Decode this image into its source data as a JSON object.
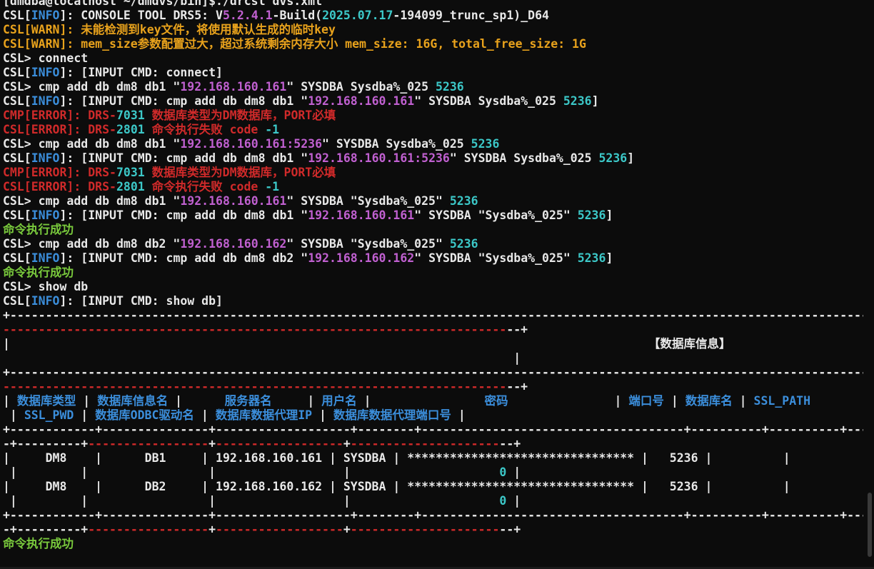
{
  "terminal": {
    "colors": {
      "white": "#e8e8e8",
      "cyan": "#3cc8c8",
      "magenta": "#c060d0",
      "blue": "#3b8edb",
      "yellow": "#e8a21c",
      "red": "#d02a2a",
      "green": "#79c93c",
      "dashred": "#d02a2a"
    },
    "lines": [
      {
        "segs": [
          {
            "t": "[dmdba@localhost ~/dmdvs/bin]$./drcsl dvs.xml",
            "c": "white"
          }
        ]
      },
      {
        "segs": [
          {
            "t": "CSL[",
            "c": "white"
          },
          {
            "t": "INFO",
            "c": "blue"
          },
          {
            "t": "]: CONSOLE TOOL DRS5: V",
            "c": "white"
          },
          {
            "t": "5.2.4.1",
            "c": "magenta"
          },
          {
            "t": "-Build(",
            "c": "white"
          },
          {
            "t": "2025.07.17",
            "c": "cyan"
          },
          {
            "t": "-194099_trunc_sp1)_D64",
            "c": "white"
          }
        ]
      },
      {
        "segs": [
          {
            "t": "CSL[WARN]: 未能检测到key文件，将使用默认生成的临时key",
            "c": "yellow"
          }
        ]
      },
      {
        "segs": [
          {
            "t": "CSL[WARN]: mem_size参数配置过大，超过系统剩余内存大小 mem_size: 16G, total_free_size: 1G",
            "c": "yellow"
          }
        ]
      },
      {
        "segs": [
          {
            "t": "CSL> connect",
            "c": "white"
          }
        ]
      },
      {
        "segs": [
          {
            "t": "CSL[",
            "c": "white"
          },
          {
            "t": "INFO",
            "c": "blue"
          },
          {
            "t": "]: [INPUT CMD: connect]",
            "c": "white"
          }
        ]
      },
      {
        "segs": [
          {
            "t": "CSL> cmp add db dm8 db1 \"",
            "c": "white"
          },
          {
            "t": "192.168.160.161",
            "c": "magenta"
          },
          {
            "t": "\" SYSDBA Sysdba%_025 ",
            "c": "white"
          },
          {
            "t": "5236",
            "c": "cyan"
          }
        ]
      },
      {
        "segs": [
          {
            "t": "CSL[",
            "c": "white"
          },
          {
            "t": "INFO",
            "c": "blue"
          },
          {
            "t": "]: [INPUT CMD: cmp add db dm8 db1 \"",
            "c": "white"
          },
          {
            "t": "192.168.160.161",
            "c": "magenta"
          },
          {
            "t": "\" SYSDBA Sysdba%_025 ",
            "c": "white"
          },
          {
            "t": "5236",
            "c": "cyan"
          },
          {
            "t": "]",
            "c": "white"
          }
        ]
      },
      {
        "segs": [
          {
            "t": "CMP[ERROR]: DRS-",
            "c": "red"
          },
          {
            "t": "7031",
            "c": "cyan"
          },
          {
            "t": " 数据库类型为DM数据库，PORT必填",
            "c": "red"
          }
        ]
      },
      {
        "segs": [
          {
            "t": "CSL[ERROR]: DRS-",
            "c": "red"
          },
          {
            "t": "2801",
            "c": "cyan"
          },
          {
            "t": " 命令执行失败 code ",
            "c": "red"
          },
          {
            "t": "-1",
            "c": "cyan"
          }
        ]
      },
      {
        "segs": [
          {
            "t": "CSL> cmp add db dm8 db1 \"",
            "c": "white"
          },
          {
            "t": "192.168.160.161:5236",
            "c": "magenta"
          },
          {
            "t": "\" SYSDBA Sysdba%_025 ",
            "c": "white"
          },
          {
            "t": "5236",
            "c": "cyan"
          }
        ]
      },
      {
        "segs": [
          {
            "t": "CSL[",
            "c": "white"
          },
          {
            "t": "INFO",
            "c": "blue"
          },
          {
            "t": "]: [INPUT CMD: cmp add db dm8 db1 \"",
            "c": "white"
          },
          {
            "t": "192.168.160.161:5236",
            "c": "magenta"
          },
          {
            "t": "\" SYSDBA Sysdba%_025 ",
            "c": "white"
          },
          {
            "t": "5236",
            "c": "cyan"
          },
          {
            "t": "]",
            "c": "white"
          }
        ]
      },
      {
        "segs": [
          {
            "t": "CMP[ERROR]: DRS-",
            "c": "red"
          },
          {
            "t": "7031",
            "c": "cyan"
          },
          {
            "t": " 数据库类型为DM数据库，PORT必填",
            "c": "red"
          }
        ]
      },
      {
        "segs": [
          {
            "t": "CSL[ERROR]: DRS-",
            "c": "red"
          },
          {
            "t": "2801",
            "c": "cyan"
          },
          {
            "t": " 命令执行失败 code ",
            "c": "red"
          },
          {
            "t": "-1",
            "c": "cyan"
          }
        ]
      },
      {
        "segs": [
          {
            "t": "CSL> cmp add db dm8 db1 \"",
            "c": "white"
          },
          {
            "t": "192.168.160.161",
            "c": "magenta"
          },
          {
            "t": "\" SYSDBA \"Sysdba%_025\" ",
            "c": "white"
          },
          {
            "t": "5236",
            "c": "cyan"
          }
        ]
      },
      {
        "segs": [
          {
            "t": "CSL[",
            "c": "white"
          },
          {
            "t": "INFO",
            "c": "blue"
          },
          {
            "t": "]: [INPUT CMD: cmp add db dm8 db1 \"",
            "c": "white"
          },
          {
            "t": "192.168.160.161",
            "c": "magenta"
          },
          {
            "t": "\" SYSDBA \"Sysdba%_025\" ",
            "c": "white"
          },
          {
            "t": "5236",
            "c": "cyan"
          },
          {
            "t": "]",
            "c": "white"
          }
        ]
      },
      {
        "segs": [
          {
            "t": "命令执行成功",
            "c": "green"
          }
        ]
      },
      {
        "segs": [
          {
            "t": "CSL> cmp add db dm8 db2 \"",
            "c": "white"
          },
          {
            "t": "192.168.160.162",
            "c": "magenta"
          },
          {
            "t": "\" SYSDBA \"Sysdba%_025\" ",
            "c": "white"
          },
          {
            "t": "5236",
            "c": "cyan"
          }
        ]
      },
      {
        "segs": [
          {
            "t": "CSL[",
            "c": "white"
          },
          {
            "t": "INFO",
            "c": "blue"
          },
          {
            "t": "]: [INPUT CMD: cmp add db dm8 db2 \"",
            "c": "white"
          },
          {
            "t": "192.168.160.162",
            "c": "magenta"
          },
          {
            "t": "\" SYSDBA \"Sysdba%_025\" ",
            "c": "white"
          },
          {
            "t": "5236",
            "c": "cyan"
          },
          {
            "t": "]",
            "c": "white"
          }
        ]
      },
      {
        "segs": [
          {
            "t": "命令执行成功",
            "c": "green"
          }
        ]
      },
      {
        "segs": [
          {
            "t": "CSL> show db",
            "c": "white"
          }
        ]
      },
      {
        "segs": [
          {
            "t": "CSL[",
            "c": "white"
          },
          {
            "t": "INFO",
            "c": "blue"
          },
          {
            "t": "]: [INPUT CMD: show db]",
            "c": "white"
          }
        ]
      },
      {
        "segs": [
          {
            "t": "+-------------------------------------------------------------------------------------------------------------------------------------------------------------------------",
            "c": "white"
          }
        ]
      },
      {
        "segs": [
          {
            "t": "-----------------------------------------------------------------------",
            "c": "dashred"
          },
          {
            "t": "--+",
            "c": "white"
          }
        ]
      },
      {
        "segs": [
          {
            "t": "|                                                                                          【数据库信息】",
            "c": "white"
          }
        ]
      },
      {
        "segs": [
          {
            "t": "                                                                        |",
            "c": "white"
          }
        ]
      },
      {
        "segs": [
          {
            "t": "+-------------------------------------------------------------------------------------------------------------------------------------------------------------------------",
            "c": "white"
          }
        ]
      },
      {
        "segs": [
          {
            "t": "-----------------------------------------------------------------------",
            "c": "dashred"
          },
          {
            "t": "--+",
            "c": "white"
          }
        ]
      },
      {
        "segs": [
          {
            "t": "| ",
            "c": "white"
          },
          {
            "t": "数据库类型",
            "c": "blue"
          },
          {
            "t": " | ",
            "c": "white"
          },
          {
            "t": "数据库信息名",
            "c": "blue"
          },
          {
            "t": " |      ",
            "c": "white"
          },
          {
            "t": "服务器名",
            "c": "blue"
          },
          {
            "t": "     | ",
            "c": "white"
          },
          {
            "t": "用户名",
            "c": "blue"
          },
          {
            "t": " |                ",
            "c": "white"
          },
          {
            "t": "密码",
            "c": "blue"
          },
          {
            "t": "               | ",
            "c": "white"
          },
          {
            "t": "端口号",
            "c": "blue"
          },
          {
            "t": " | ",
            "c": "white"
          },
          {
            "t": "数据库名",
            "c": "blue"
          },
          {
            "t": " | ",
            "c": "white"
          },
          {
            "t": "SSL_PATH",
            "c": "blue"
          }
        ]
      },
      {
        "segs": [
          {
            "t": " | ",
            "c": "white"
          },
          {
            "t": "SSL_PWD",
            "c": "blue"
          },
          {
            "t": " | ",
            "c": "white"
          },
          {
            "t": "数据库ODBC驱动名",
            "c": "blue"
          },
          {
            "t": " | ",
            "c": "white"
          },
          {
            "t": "数据库数据代理IP",
            "c": "blue"
          },
          {
            "t": " | ",
            "c": "white"
          },
          {
            "t": "数据库数据代理端口号",
            "c": "blue"
          },
          {
            "t": " |",
            "c": "white"
          }
        ]
      },
      {
        "segs": [
          {
            "t": "+------------+---------------+-------------------+--------+-------------------------------------+----------+----------+----------",
            "c": "white"
          }
        ]
      },
      {
        "segs": [
          {
            "t": "-+---------+",
            "c": "white"
          },
          {
            "t": "-----------------",
            "c": "dashred"
          },
          {
            "t": "+",
            "c": "white"
          },
          {
            "t": "------------------",
            "c": "dashred"
          },
          {
            "t": "+",
            "c": "white"
          },
          {
            "t": "---------------------",
            "c": "dashred"
          },
          {
            "t": "--+",
            "c": "white"
          }
        ]
      },
      {
        "segs": [
          {
            "t": "|     DM8    |      DB1     | 192.168.160.161 | SYSDBA | ******************************** |   5236 |          |",
            "c": "white"
          }
        ]
      },
      {
        "segs": [
          {
            "t": " |         |                 |                  |                     ",
            "c": "white"
          },
          {
            "t": "0",
            "c": "cyan"
          },
          {
            "t": " |",
            "c": "white"
          }
        ]
      },
      {
        "segs": [
          {
            "t": "|     DM8    |      DB2     | 192.168.160.162 | SYSDBA | ******************************** |   5236 |          |",
            "c": "white"
          }
        ]
      },
      {
        "segs": [
          {
            "t": " |         |                 |                  |                     ",
            "c": "white"
          },
          {
            "t": "0",
            "c": "cyan"
          },
          {
            "t": " |",
            "c": "white"
          }
        ]
      },
      {
        "segs": [
          {
            "t": "+------------+---------------+-------------------+--------+-------------------------------------+----------+----------+----------",
            "c": "white"
          }
        ]
      },
      {
        "segs": [
          {
            "t": "-+---------+",
            "c": "white"
          },
          {
            "t": "-----------------",
            "c": "dashred"
          },
          {
            "t": "+",
            "c": "white"
          },
          {
            "t": "------------------",
            "c": "dashred"
          },
          {
            "t": "+",
            "c": "white"
          },
          {
            "t": "---------------------",
            "c": "dashred"
          },
          {
            "t": "--+",
            "c": "white"
          }
        ]
      },
      {
        "segs": [
          {
            "t": "命令执行成功",
            "c": "green"
          }
        ]
      }
    ]
  }
}
